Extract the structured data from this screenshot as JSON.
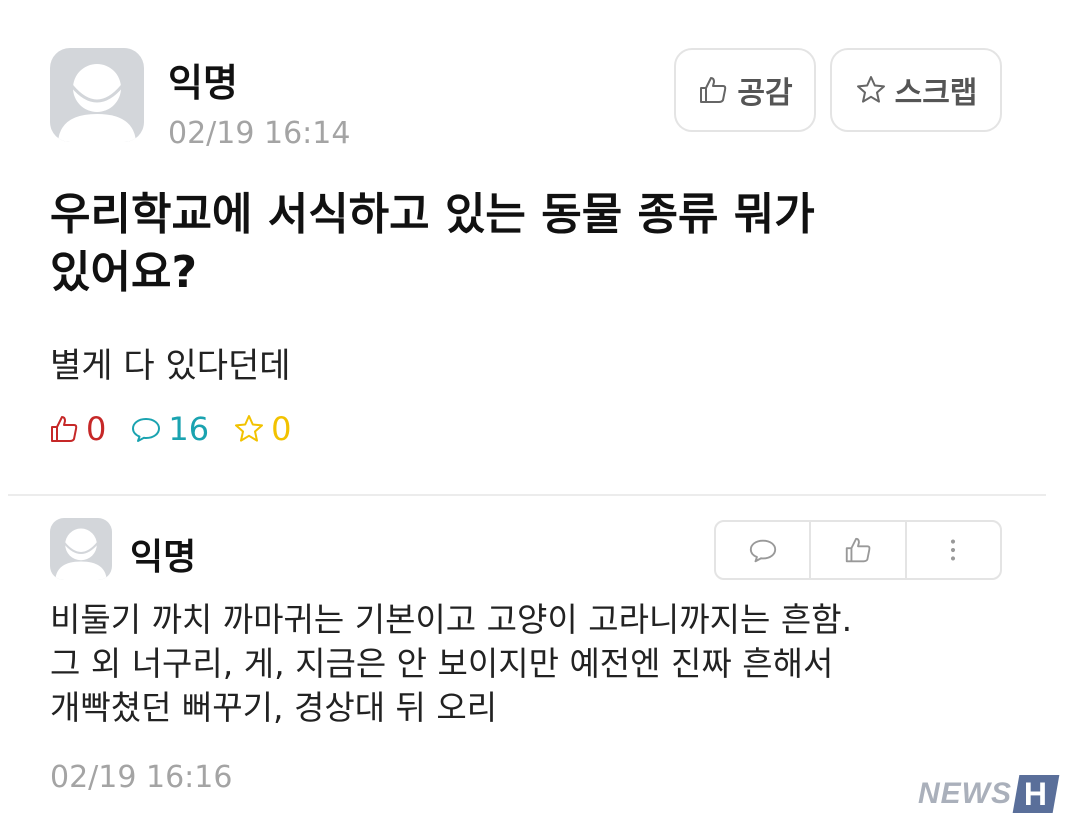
{
  "post": {
    "author": "익명",
    "time": "02/19 16:14",
    "like_button_label": "공감",
    "scrap_button_label": "스크랩",
    "title": "우리학교에 서식하고 있는 동물 종류 뭐가있어요?",
    "body": "별게 다 있다던데",
    "stats": {
      "likes": "0",
      "comments": "16",
      "scraps": "0"
    }
  },
  "comment": {
    "author": "익명",
    "text_lines": [
      "비둘기 까치 까마귀는 기본이고 고양이 고라니까지는 흔함.",
      "그 외 너구리, 게, 지금은 안 보이지만 예전엔 진짜 흔해서",
      "개빡쳤던 뻐꾸기, 경상대 뒤 오리"
    ],
    "time": "02/19 16:16"
  },
  "watermark": {
    "text": "NEWS",
    "letter": "H"
  },
  "colors": {
    "like": "#c62828",
    "comment": "#1aa3b0",
    "scrap": "#f2c200",
    "muted_text": "#a4a4a4"
  }
}
